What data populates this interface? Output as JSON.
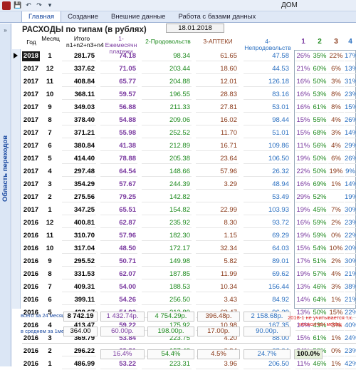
{
  "window": {
    "title": "ДОМ"
  },
  "tabs": [
    {
      "label": "Главная",
      "active": true
    },
    {
      "label": "Создание",
      "active": false
    },
    {
      "label": "Внешние данные",
      "active": false
    },
    {
      "label": "Работа с базами данных",
      "active": false
    }
  ],
  "nav": {
    "label": "Область переходов",
    "toggle": "»"
  },
  "form": {
    "title": "РАСХОДЫ по типам (в рублях)",
    "date": "18.01.2018",
    "headers": {
      "year": "Год",
      "month": "Месяц",
      "total": "Итого n1+n2+n3+n4",
      "c1": "1-Ежемесячн платежи",
      "c2": "2-Продовольств",
      "c3": "3-АПТЕКИ",
      "c4": "4-Непродовольств",
      "p1": "1",
      "p2": "2",
      "p3": "3",
      "p4": "4"
    }
  },
  "colors": {
    "purple": "#7a3aa0",
    "green": "#1e8a1e",
    "brown": "#8a3a1a",
    "blue": "#2a6fc0",
    "red": "#d22222"
  },
  "rows": [
    {
      "year": "2018",
      "month": "1",
      "total": "281.75",
      "c1": "74.18",
      "c2": "98.34",
      "c3": "61.65",
      "c4": "47.58",
      "p1": "26%",
      "p2": "35%",
      "p3": "22%",
      "p4": "17%",
      "selected": true
    },
    {
      "year": "2017",
      "month": "12",
      "total": "337.62",
      "c1": "71.05",
      "c2": "203.44",
      "c3": "18.60",
      "c4": "44.53",
      "p1": "21%",
      "p2": "60%",
      "p3": "6%",
      "p4": "13%"
    },
    {
      "year": "2017",
      "month": "11",
      "total": "408.84",
      "c1": "65.77",
      "c2": "204.88",
      "c3": "12.01",
      "c4": "126.18",
      "p1": "16%",
      "p2": "50%",
      "p3": "3%",
      "p4": "31%"
    },
    {
      "year": "2017",
      "month": "10",
      "total": "368.11",
      "c1": "59.57",
      "c2": "196.55",
      "c3": "28.83",
      "c4": "83.16",
      "p1": "16%",
      "p2": "53%",
      "p3": "8%",
      "p4": "23%"
    },
    {
      "year": "2017",
      "month": "9",
      "total": "349.03",
      "c1": "56.88",
      "c2": "211.33",
      "c3": "27.81",
      "c4": "53.01",
      "p1": "16%",
      "p2": "61%",
      "p3": "8%",
      "p4": "15%"
    },
    {
      "year": "2017",
      "month": "8",
      "total": "378.40",
      "c1": "54.88",
      "c2": "209.06",
      "c3": "16.02",
      "c4": "98.44",
      "p1": "15%",
      "p2": "55%",
      "p3": "4%",
      "p4": "26%"
    },
    {
      "year": "2017",
      "month": "7",
      "total": "371.21",
      "c1": "55.98",
      "c2": "252.52",
      "c3": "11.70",
      "c4": "51.01",
      "p1": "15%",
      "p2": "68%",
      "p3": "3%",
      "p4": "14%"
    },
    {
      "year": "2017",
      "month": "6",
      "total": "380.84",
      "c1": "41.38",
      "c2": "212.89",
      "c3": "16.71",
      "c4": "109.86",
      "p1": "11%",
      "p2": "56%",
      "p3": "4%",
      "p4": "29%"
    },
    {
      "year": "2017",
      "month": "5",
      "total": "414.40",
      "c1": "78.88",
      "c2": "205.38",
      "c3": "23.64",
      "c4": "106.50",
      "p1": "19%",
      "p2": "50%",
      "p3": "6%",
      "p4": "26%"
    },
    {
      "year": "2017",
      "month": "4",
      "total": "297.48",
      "c1": "64.54",
      "c2": "148.66",
      "c3": "57.96",
      "c4": "26.32",
      "p1": "22%",
      "p2": "50%",
      "p3": "19%",
      "p4": "9%"
    },
    {
      "year": "2017",
      "month": "3",
      "total": "354.29",
      "c1": "57.67",
      "c2": "244.39",
      "c3": "3.29",
      "c4": "48.94",
      "p1": "16%",
      "p2": "69%",
      "p3": "1%",
      "p4": "14%"
    },
    {
      "year": "2017",
      "month": "2",
      "total": "275.56",
      "c1": "79.25",
      "c2": "142.82",
      "c3": "",
      "c4": "53.49",
      "p1": "29%",
      "p2": "52%",
      "p3": "",
      "p4": "19%"
    },
    {
      "year": "2017",
      "month": "1",
      "total": "347.25",
      "c1": "65.51",
      "c2": "154.82",
      "c3": "22.99",
      "c4": "103.93",
      "p1": "19%",
      "p2": "45%",
      "p3": "7%",
      "p4": "30%"
    },
    {
      "year": "2016",
      "month": "12",
      "total": "400.81",
      "c1": "62.87",
      "c2": "235.92",
      "c3": "8.30",
      "c4": "93.72",
      "p1": "16%",
      "p2": "59%",
      "p3": "2%",
      "p4": "23%"
    },
    {
      "year": "2016",
      "month": "11",
      "total": "310.70",
      "c1": "57.96",
      "c2": "182.30",
      "c3": "1.15",
      "c4": "69.29",
      "p1": "19%",
      "p2": "59%",
      "p3": "0%",
      "p4": "22%"
    },
    {
      "year": "2016",
      "month": "10",
      "total": "317.04",
      "c1": "48.50",
      "c2": "172.17",
      "c3": "32.34",
      "c4": "64.03",
      "p1": "15%",
      "p2": "54%",
      "p3": "10%",
      "p4": "20%"
    },
    {
      "year": "2016",
      "month": "9",
      "total": "295.52",
      "c1": "50.71",
      "c2": "149.98",
      "c3": "5.82",
      "c4": "89.01",
      "p1": "17%",
      "p2": "51%",
      "p3": "2%",
      "p4": "30%"
    },
    {
      "year": "2016",
      "month": "8",
      "total": "331.53",
      "c1": "62.07",
      "c2": "187.85",
      "c3": "11.99",
      "c4": "69.62",
      "p1": "19%",
      "p2": "57%",
      "p3": "4%",
      "p4": "21%"
    },
    {
      "year": "2016",
      "month": "7",
      "total": "409.31",
      "c1": "54.00",
      "c2": "188.53",
      "c3": "10.34",
      "c4": "156.44",
      "p1": "13%",
      "p2": "46%",
      "p3": "3%",
      "p4": "38%"
    },
    {
      "year": "2016",
      "month": "6",
      "total": "399.11",
      "c1": "54.26",
      "c2": "256.50",
      "c3": "3.43",
      "c4": "84.92",
      "p1": "14%",
      "p2": "64%",
      "p3": "1%",
      "p4": "21%"
    },
    {
      "year": "2016",
      "month": "5",
      "total": "428.67",
      "c1": "54.92",
      "c2": "213.89",
      "c3": "63.47",
      "c4": "96.39",
      "p1": "13%",
      "p2": "50%",
      "p3": "15%",
      "p4": "22%"
    },
    {
      "year": "2016",
      "month": "4",
      "total": "413.47",
      "c1": "59.22",
      "c2": "175.92",
      "c3": "10.98",
      "c4": "167.35",
      "p1": "14%",
      "p2": "43%",
      "p3": "3%",
      "p4": "40%"
    },
    {
      "year": "2016",
      "month": "3",
      "total": "369.79",
      "c1": "53.84",
      "c2": "223.75",
      "c3": "4.20",
      "c4": "88.00",
      "p1": "15%",
      "p2": "61%",
      "p3": "1%",
      "p4": "24%"
    },
    {
      "year": "2016",
      "month": "2",
      "total": "296.22",
      "c1": "69.81",
      "c2": "157.43",
      "c3": "0.94",
      "c4": "68.04",
      "p1": "24%",
      "p2": "53%",
      "p3": "0%",
      "p4": "23%"
    },
    {
      "year": "2016",
      "month": "1",
      "total": "486.99",
      "c1": "53.22",
      "c2": "223.31",
      "c3": "3.96",
      "c4": "206.50",
      "p1": "11%",
      "p2": "46%",
      "p3": "1%",
      "p4": "42%"
    }
  ],
  "summary": {
    "total_label": "всего за 24 месяца",
    "avg_label": "в среднем за 1мес",
    "total": "8 742.19",
    "c1_total": "1 432.74р.",
    "c2_total": "4 754.29р.",
    "c3_total": "396.48р.",
    "c4_total": "2 158.68р.",
    "avg": "364.00",
    "c1_avg": "60.00р.",
    "c2_avg": "198.00р.",
    "c3_avg": "17.00р.",
    "c4_avg": "90.00р.",
    "p1": "16.4%",
    "p2": "54.4%",
    "p3": "4.5%",
    "p4": "24.7%",
    "p_total": "100.0%",
    "note": "2018-1 не учитывается т.к. неокончен месяц"
  }
}
